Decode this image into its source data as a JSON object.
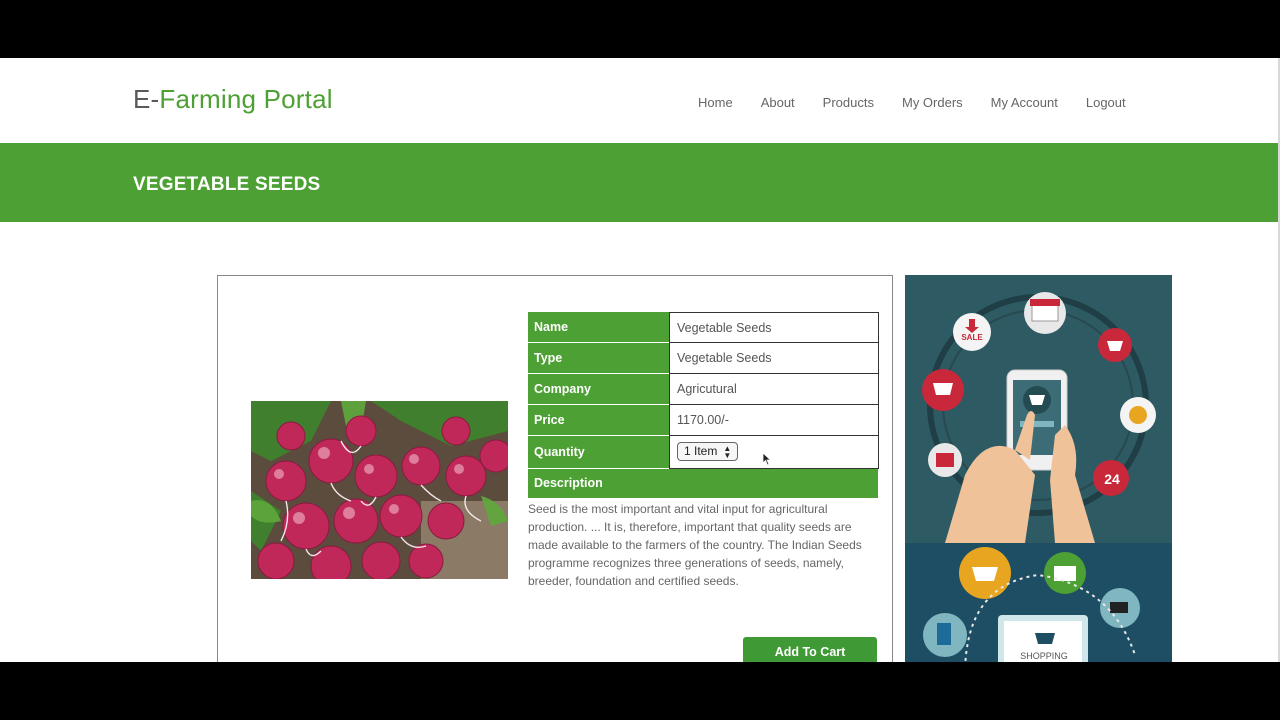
{
  "header": {
    "logo_prefix": "E-",
    "logo_word1": "Farming",
    "logo_word2": " Portal",
    "nav": [
      "Home",
      "About",
      "Products",
      "My Orders",
      "My Account",
      "Logout"
    ]
  },
  "banner": {
    "title": "VEGETABLE SEEDS"
  },
  "product": {
    "rows": [
      {
        "label": "Name",
        "value": "Vegetable Seeds"
      },
      {
        "label": "Type",
        "value": "Vegetable Seeds"
      },
      {
        "label": "Company",
        "value": "Agricutural"
      },
      {
        "label": "Price",
        "value": "1170.00/-"
      }
    ],
    "quantity_label": "Quantity",
    "quantity_value": "1 Item",
    "description_label": "Description",
    "description": "Seed is the most important and vital input for agricultural production. ... It is, therefore, important that quality seeds are made available to the farmers of the country. The Indian Seeds programme recognizes three generations of seeds, namely, breeder, foundation and certified seeds.",
    "add_to_cart": "Add To Cart"
  },
  "side_art": {
    "sale_badge": "SALE",
    "clock_badge": "24",
    "shopping_sign": "SHOPPING"
  },
  "colors": {
    "brand_green": "#4da033",
    "nav_text": "#666666"
  }
}
